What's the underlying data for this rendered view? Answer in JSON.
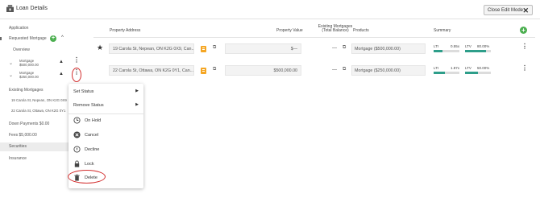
{
  "header": {
    "title": "Loan Details",
    "close_button": "Close Edit Mode",
    "close_icon": "✕"
  },
  "nav": {
    "application": "Application",
    "requested_mortgage": "Requested Mortgage",
    "overview": "Overview",
    "mortgages": [
      {
        "line1": "Mortgage",
        "line2": "$500,000.00"
      },
      {
        "line1": "Mortgage",
        "line2": "$250,000.00"
      }
    ],
    "existing_mortgages": "Existing Mortgages",
    "existing_items": [
      "19 Carola St, Nepean, ON K2G 0X9",
      "22 Carola St, Ottawa, ON K2G 0Y1"
    ],
    "down_payments": "Down Payments $0.00",
    "fees": "Fees $5,000.00",
    "securities": "Securities",
    "insurance": "Insurance"
  },
  "table": {
    "headers": {
      "property_address": "Property Address",
      "property_value": "Property Value",
      "existing_mortgages_l1": "Existing Mortgages",
      "existing_mortgages_l2": "(Total Balance)",
      "products": "Products",
      "summary": "Summary"
    },
    "rows": [
      {
        "starred": true,
        "address": "19 Carola St, Nepean, ON K2G 0X9, Can...",
        "property_value": "$—",
        "existing_balance": "—",
        "product": "Mortgage ($500,000.00)",
        "lti_label": "LTI",
        "lti_value": "0.55x",
        "lti_fill": 0.35,
        "ltv_label": "LTV",
        "ltv_value": "80.00%",
        "ltv_fill": 0.8
      },
      {
        "starred": false,
        "address": "22 Carola St, Ottawa, ON K2G 0Y1, Can...",
        "property_value": "$500,000.00",
        "existing_balance": "—",
        "product": "Mortgage ($250,000.00)",
        "lti_label": "LTI",
        "lti_value": "1.87x",
        "lti_fill": 0.45,
        "ltv_label": "LTV",
        "ltv_value": "50.00%",
        "ltv_fill": 0.5
      }
    ]
  },
  "menu": {
    "set_status": "Set Status",
    "remove_status": "Remove Status",
    "on_hold": "On Hold",
    "cancel": "Cancel",
    "decline": "Decline",
    "lock": "Lock",
    "delete": "Delete"
  },
  "colors": {
    "accent_green": "#4caf50",
    "bar_fill": "#2e9e8a",
    "doc_orange": "#f5a623",
    "highlight_red": "#d32f2f"
  }
}
